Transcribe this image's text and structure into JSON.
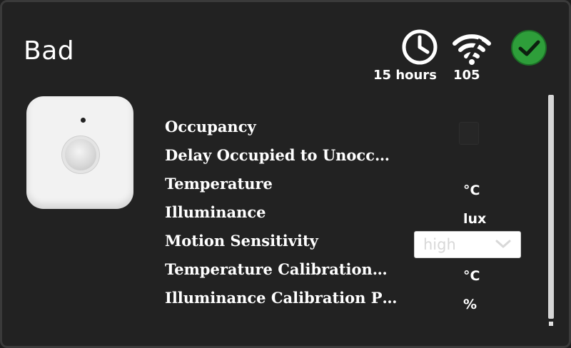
{
  "title": "Bad",
  "status": {
    "last_seen": "15 hours",
    "link_quality": "105",
    "clock_icon": "clock-icon",
    "signal_icon": "wifi-signal-icon",
    "ok_icon": "check-circle-icon",
    "ok_color": "#2e9e3a"
  },
  "device_image": "motion-sensor-image",
  "rows": [
    {
      "label": "Occupancy",
      "unit": ""
    },
    {
      "label": "Delay Occupied to Unocc…",
      "unit": ""
    },
    {
      "label": "Temperature",
      "unit": "°C"
    },
    {
      "label": "Illuminance",
      "unit": "lux"
    },
    {
      "label": "Motion Sensitivity",
      "unit": ""
    },
    {
      "label": "Temperature Calibration…",
      "unit": "°C"
    },
    {
      "label": "Illuminance Calibration P…",
      "unit": "%"
    }
  ],
  "motion_sensitivity": {
    "selected": "high",
    "icon": "chevron-down-icon"
  }
}
